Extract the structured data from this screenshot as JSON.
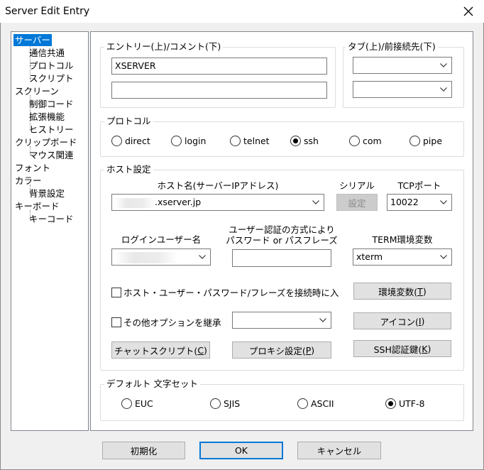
{
  "window": {
    "title": "Server Edit Entry",
    "close_glyph": "✕"
  },
  "tree": {
    "items": [
      {
        "label": "サーバー",
        "selected": true
      },
      {
        "label": "通信共通"
      },
      {
        "label": "プロトコル"
      },
      {
        "label": "スクリプト"
      },
      {
        "label": "スクリーン"
      },
      {
        "label": "制御コード"
      },
      {
        "label": "拡張機能"
      },
      {
        "label": "ヒストリー"
      },
      {
        "label": "クリップボード"
      },
      {
        "label": "マウス関連"
      },
      {
        "label": "フォント"
      },
      {
        "label": "カラー"
      },
      {
        "label": "背景設定"
      },
      {
        "label": "キーボード"
      },
      {
        "label": "キーコード"
      }
    ]
  },
  "entry": {
    "group_label": "エントリー(上)/コメント(下)",
    "entry_value": "XSERVER",
    "comment_value": ""
  },
  "tab": {
    "group_label": "タブ(上)/前接続先(下)",
    "tab_value": "",
    "prev_value": ""
  },
  "protocol": {
    "group_label": "プロトコル",
    "options": [
      "direct",
      "login",
      "telnet",
      "ssh",
      "com",
      "pipe"
    ],
    "selected": "ssh"
  },
  "host": {
    "group_label": "ホスト設定",
    "hostname_label": "ホスト名(サーバーIPアドレス)",
    "hostname_value": ".xserver.jp",
    "serial_label": "シリアル",
    "serial_button": "設定",
    "tcp_port_label": "TCPポート",
    "tcp_port_value": "10022",
    "login_user_label": "ログインユーザー名",
    "login_user_value": "",
    "auth_label_line1": "ユーザー認証の方式により",
    "auth_label_line2": "パスワード or パスフレーズ",
    "auth_value": "",
    "term_label": "TERM環境変数",
    "term_value": "xterm",
    "save_password_label": "ホスト・ユーザー・パスワード/フレーズを接続時に入力",
    "env_button": "環境変数(T)",
    "env_button_main": "環境変数(",
    "env_button_key": "T",
    "env_button_tail": ")",
    "inherit_label": "その他オプションを継承",
    "inherit_value": "",
    "icon_button_main": "アイコン(",
    "icon_button_key": "I",
    "icon_button_tail": ")",
    "chat_button_main": "チャットスクリプト(",
    "chat_button_key": "C",
    "chat_button_tail": ")",
    "proxy_button_main": "プロキシ設定(",
    "proxy_button_key": "P",
    "proxy_button_tail": ")",
    "ssh_key_button_main": "SSH認証鍵(",
    "ssh_key_button_key": "K",
    "ssh_key_button_tail": ")"
  },
  "charset": {
    "group_label": "デフォルト 文字セット",
    "options": [
      "EUC",
      "SJIS",
      "ASCII",
      "UTF-8"
    ],
    "selected": "UTF-8"
  },
  "footer": {
    "init_button": "初期化",
    "ok_button": "OK",
    "cancel_button": "キャンセル"
  }
}
